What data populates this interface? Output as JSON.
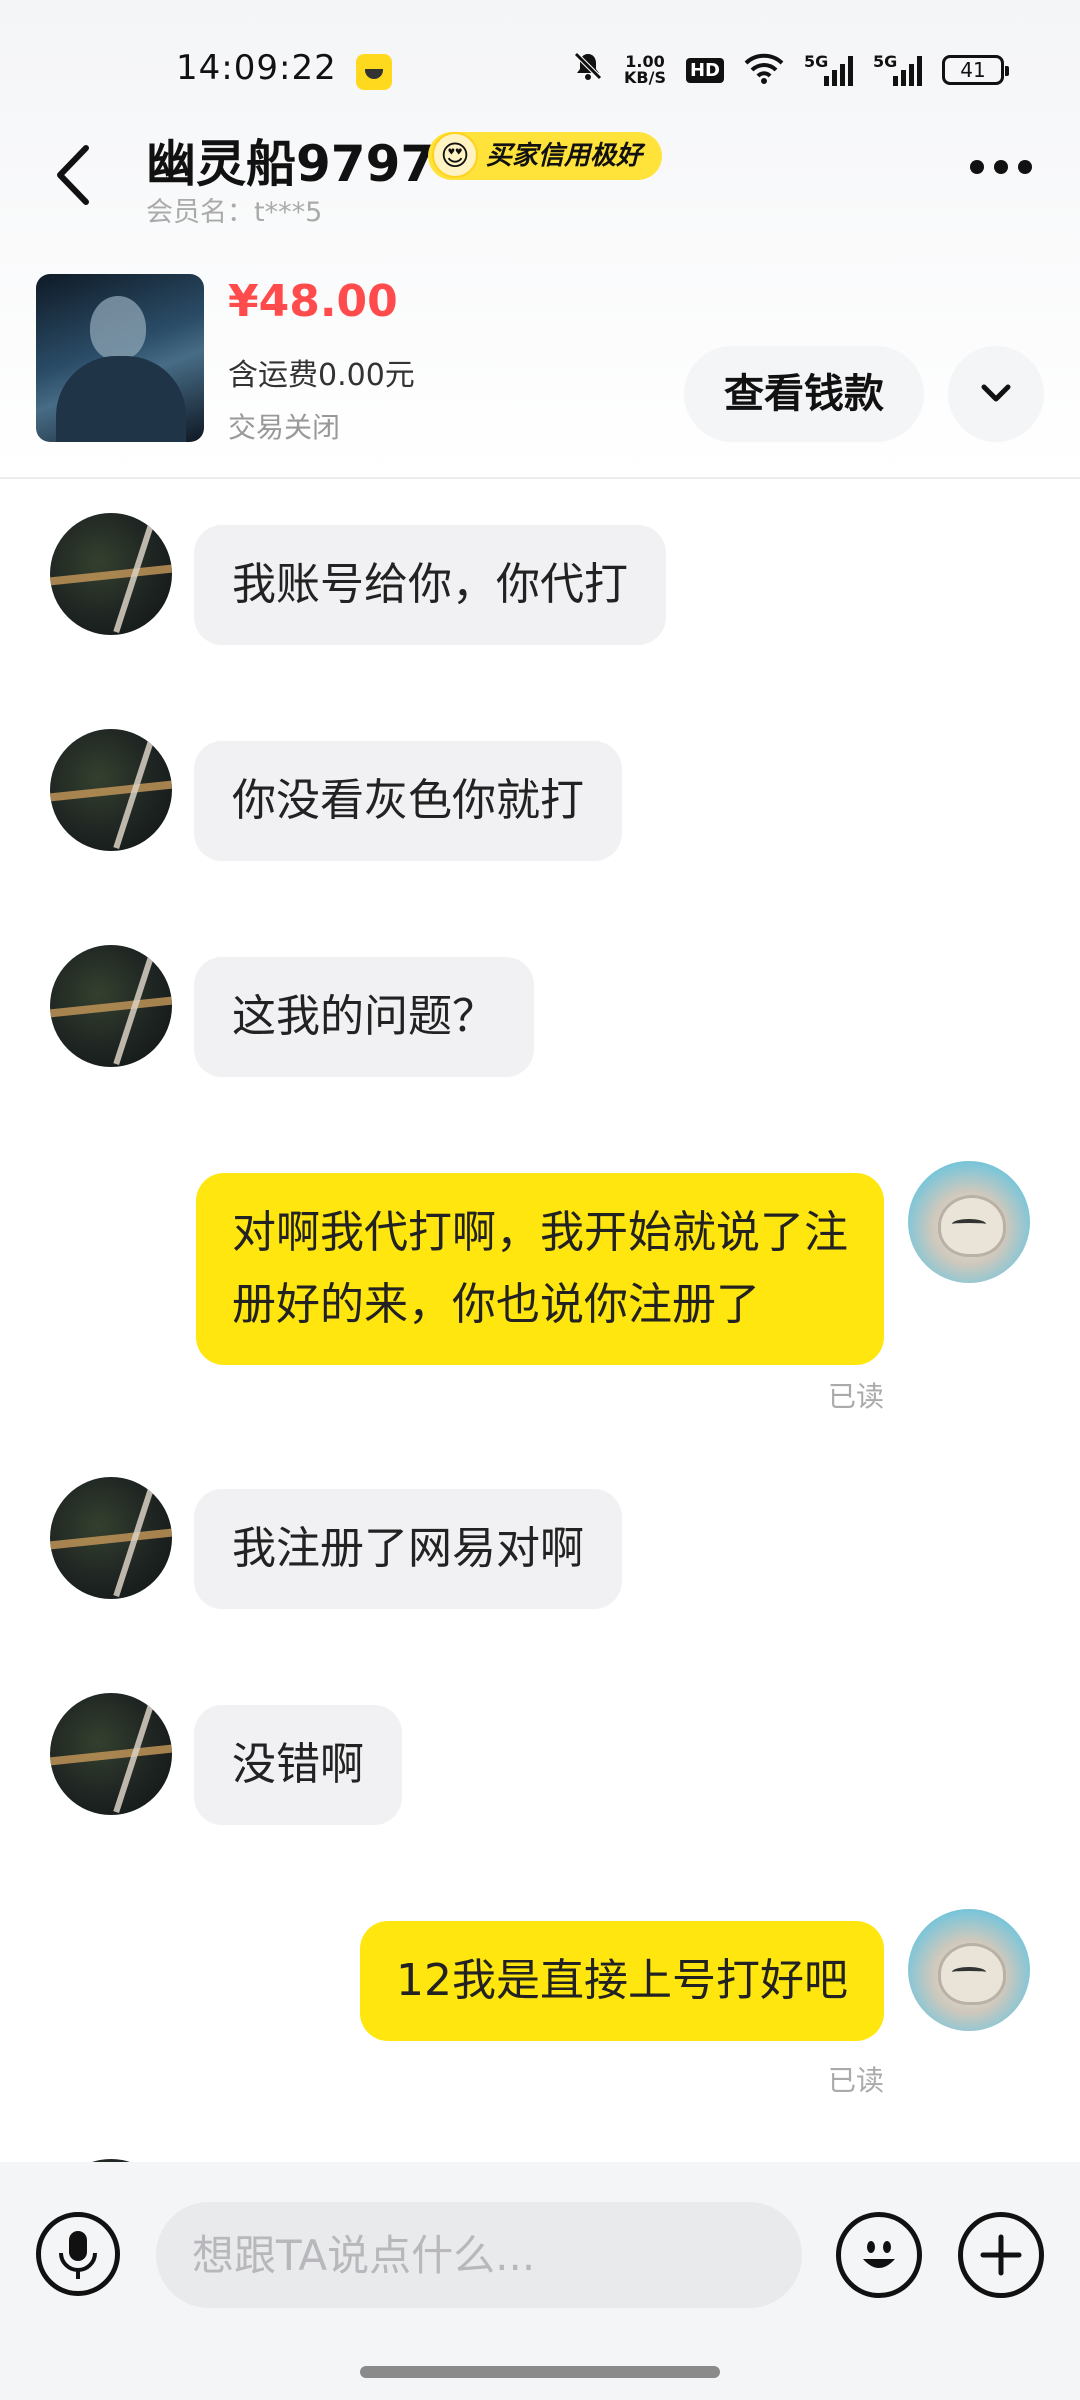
{
  "status_bar": {
    "time": "14:09:22",
    "net_speed_value": "1.00",
    "net_speed_unit": "KB/S",
    "hd_label": "HD",
    "signal1_label": "5G",
    "signal2_label": "5G",
    "battery": "41"
  },
  "header": {
    "title": "幽灵船9797",
    "badge": "买家信用极好",
    "member": "会员名：t***5"
  },
  "product": {
    "price": "¥48.00",
    "shipping": "含运费0.00元",
    "status": "交易关闭",
    "view_money_label": "查看钱款"
  },
  "messages": [
    {
      "sender": "other",
      "text": "我账号给你，你代打"
    },
    {
      "sender": "other",
      "text": "你没看灰色你就打"
    },
    {
      "sender": "other",
      "text": "这我的问题？"
    },
    {
      "sender": "me",
      "line1": "对啊我代打啊，我开始就说了注",
      "line2": "册好的来，你也说你注册了",
      "read": "已读"
    },
    {
      "sender": "other",
      "text": "我注册了网易对啊"
    },
    {
      "sender": "other",
      "text": "没错啊"
    },
    {
      "sender": "me",
      "text": "12我是直接上号打好吧",
      "read": "已读"
    }
  ],
  "input": {
    "placeholder": "想跟TA说点什么..."
  },
  "colors": {
    "accent_yellow": "#ffe60f",
    "price_red": "#ff4b4b",
    "bubble_gray": "#f1f1f3"
  }
}
